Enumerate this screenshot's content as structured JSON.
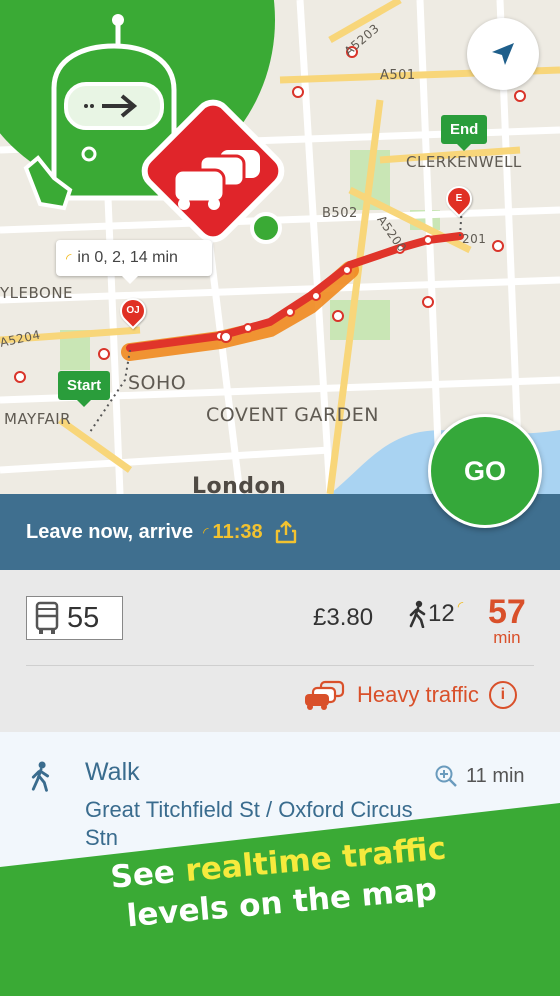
{
  "map": {
    "labels": {
      "clerkenwell": "CLERKENWELL",
      "soho": "SOHO",
      "covent_garden": "COVENT GARDEN",
      "mayfair": "MAYFAIR",
      "marylebone": "YLEBONE",
      "london": "London",
      "a501": "A501",
      "a5203": "A5203",
      "b502": "B502",
      "a5200": "A5200",
      "a201": "201",
      "a5204": "A5204"
    },
    "eta_bubble": "in 0, 2, 14 min",
    "start_flag": "Start",
    "end_flag": "End",
    "pin_origin": "OJ",
    "pin_end": "E",
    "colors": {
      "route_heavy": "#e0342a",
      "route_moderate": "#f08a1e",
      "green": "#3aaa35"
    }
  },
  "go_button": "GO",
  "journey": {
    "leave_label": "Leave now, arrive",
    "arrive_time": "11:38",
    "bus_number": "55",
    "price": "£3.80",
    "walk_minutes": "12",
    "total_minutes": "57",
    "total_unit": "min",
    "traffic_status": "Heavy traffic",
    "info": "i"
  },
  "step": {
    "mode": "Walk",
    "duration": "11 min",
    "description": "Great Titchfield St / Oxford Circus Stn"
  },
  "promo": {
    "line1_prefix": "See ",
    "line1_highlight": "realtime traffic",
    "line2": "levels on the map"
  },
  "icons": [
    "compass-arrow-icon",
    "realtime-signal-icon",
    "share-icon",
    "bus-icon",
    "walking-person-icon",
    "cars-icon",
    "info-icon",
    "zoom-in-icon",
    "robot-mascot-icon",
    "traffic-cars-icon"
  ]
}
